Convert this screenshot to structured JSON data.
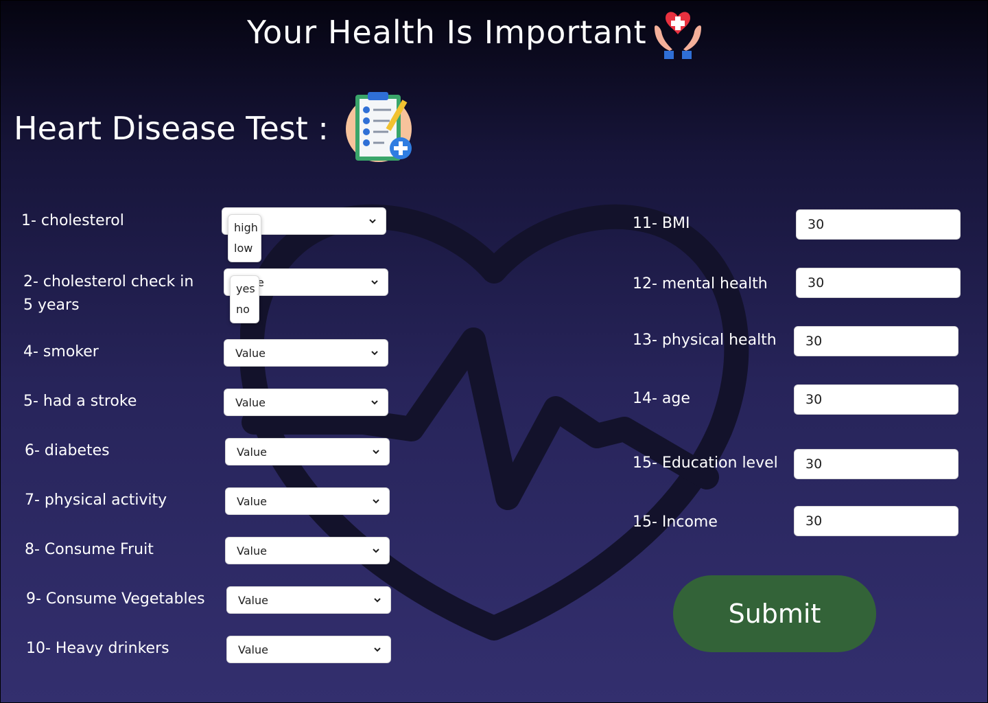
{
  "header": {
    "title": "Your Health Is Important",
    "icon": "hands-heart-icon"
  },
  "test_title": "Heart Disease Test :",
  "test_icon": "clipboard-checklist-icon",
  "left_fields": [
    {
      "label": "1- cholesterol",
      "value": ""
    },
    {
      "label": "2- cholesterol  check in 5 years",
      "value": ""
    },
    {
      "label": "4- smoker",
      "value": "Value"
    },
    {
      "label": "5- had a stroke",
      "value": "Value"
    },
    {
      "label": "6- diabetes",
      "value": "Value"
    },
    {
      "label": "7- physical activity",
      "value": "Value"
    },
    {
      "label": "8- Consume Fruit",
      "value": "Value"
    },
    {
      "label": "9- Consume Vegetables",
      "value": "Value"
    },
    {
      "label": "10- Heavy drinkers",
      "value": "Value"
    }
  ],
  "dropdowns": {
    "cholesterol": [
      "high",
      "low"
    ],
    "cholesterol_check": [
      "yes",
      "no"
    ],
    "partial_text": "e"
  },
  "right_fields": [
    {
      "label": "11- BMI",
      "value": "30"
    },
    {
      "label": "12- mental health",
      "value": "30"
    },
    {
      "label": "13- physical health",
      "value": "30"
    },
    {
      "label": "14- age",
      "value": "30"
    },
    {
      "label": "15- Education level",
      "value": "30"
    },
    {
      "label": "15- Income",
      "value": "30"
    }
  ],
  "submit_label": "Submit",
  "colors": {
    "submit": "#336338",
    "background_top": "#050410",
    "background_bottom": "#332f6e",
    "heart_outline": "#13122b"
  }
}
